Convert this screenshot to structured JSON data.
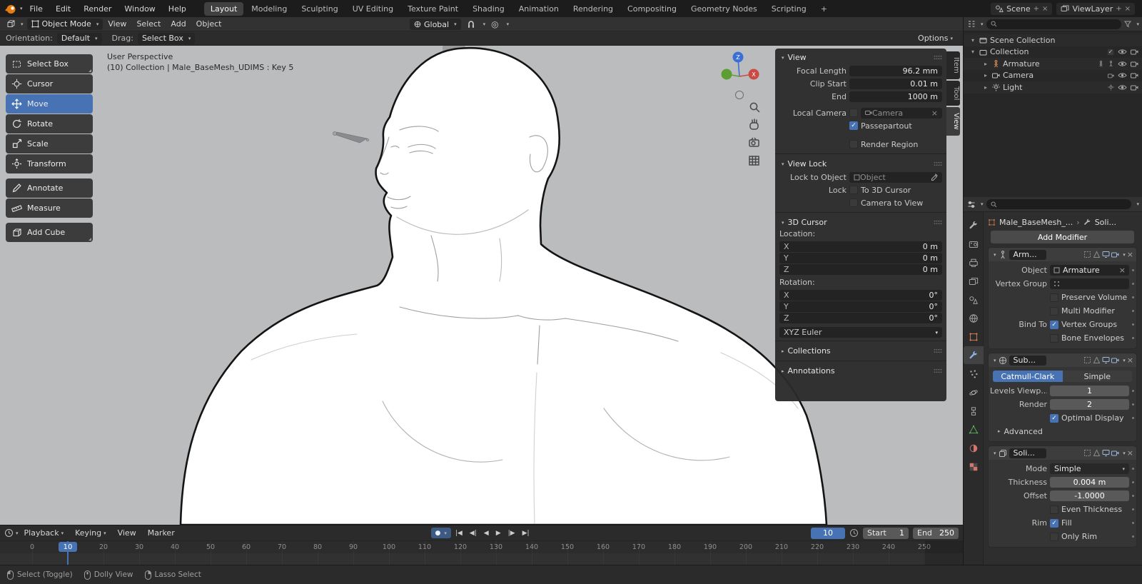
{
  "colors": {
    "accent": "#4772b3",
    "axis_x": "#cc4a44",
    "axis_y": "#5c9e31",
    "axis_z": "#3c6fd6",
    "viewport_bg": "#bbbcbe"
  },
  "topbar": {
    "menus": [
      "File",
      "Edit",
      "Render",
      "Window",
      "Help"
    ],
    "workspaces": [
      "Layout",
      "Modeling",
      "Sculpting",
      "UV Editing",
      "Texture Paint",
      "Shading",
      "Animation",
      "Rendering",
      "Compositing",
      "Geometry Nodes",
      "Scripting"
    ],
    "add_workspace": "+",
    "scene": "Scene",
    "view_layer": "ViewLayer"
  },
  "header": {
    "mode": "Object Mode",
    "menus": [
      "View",
      "Select",
      "Add",
      "Object"
    ],
    "orientation": "Global"
  },
  "tools_bar": {
    "orientation_label": "Orientation:",
    "orientation_value": "Default",
    "drag_label": "Drag:",
    "drag_value": "Select Box",
    "options": "Options"
  },
  "toolshelf": {
    "tools": [
      {
        "label": "Select Box"
      },
      {
        "label": "Cursor"
      },
      {
        "label": "Move"
      },
      {
        "label": "Rotate"
      },
      {
        "label": "Scale"
      },
      {
        "label": "Transform"
      },
      {
        "label": "Annotate"
      },
      {
        "label": "Measure"
      },
      {
        "label": "Add Cube"
      }
    ]
  },
  "viewport": {
    "perspective": "User Perspective",
    "context": "(10) Collection | Male_BaseMesh_UDIMS : Key 5",
    "axis_x": "X",
    "axis_z": "Z"
  },
  "npanel": {
    "tabs": [
      {
        "label": "Item"
      },
      {
        "label": "Tool"
      },
      {
        "label": "View"
      }
    ],
    "view_title": "View",
    "focal_label": "Focal Length",
    "focal_value": "96.2 mm",
    "clip_label": "Clip Start",
    "clip_value": "0.01 m",
    "end_label": "End",
    "end_value": "1000 m",
    "local_camera": "Local Camera",
    "camera_value": "Camera",
    "passepartout": "Passepartout",
    "render_region": "Render Region",
    "lock_title": "View Lock",
    "lock_to_object": "Lock to Object",
    "object_placeholder": "Object",
    "lock_label": "Lock",
    "to_3d_cursor": "To 3D Cursor",
    "camera_to_view": "Camera to View",
    "cursor_title": "3D Cursor",
    "location_label": "Location:",
    "loc": [
      {
        "axis": "X",
        "value": "0 m"
      },
      {
        "axis": "Y",
        "value": "0 m"
      },
      {
        "axis": "Z",
        "value": "0 m"
      }
    ],
    "rotation_label": "Rotation:",
    "rot": [
      {
        "axis": "X",
        "value": "0°"
      },
      {
        "axis": "Y",
        "value": "0°"
      },
      {
        "axis": "Z",
        "value": "0°"
      }
    ],
    "euler": "XYZ Euler",
    "collections_title": "Collections",
    "annotations_title": "Annotations"
  },
  "outliner": {
    "rows": [
      {
        "label": "Scene Collection"
      },
      {
        "label": "Collection"
      },
      {
        "label": "Armature"
      },
      {
        "label": "Camera"
      },
      {
        "label": "Light"
      }
    ]
  },
  "properties": {
    "breadcrumb_object": "Male_BaseMesh_...",
    "breadcrumb_sep": "›",
    "breadcrumb_modifier": "Soli...",
    "add_modifier": "Add Modifier",
    "armature": {
      "name": "Arm...",
      "object_label": "Object",
      "object_value": "Armature",
      "vertex_group_label": "Vertex Group",
      "preserve_volume": "Preserve Volume",
      "multi_modifier": "Multi Modifier",
      "bind_to_label": "Bind To",
      "vertex_groups": "Vertex Groups",
      "bone_envelopes": "Bone Envelopes"
    },
    "subdivision": {
      "name": "Sub...",
      "catmull": "Catmull-Clark",
      "simple": "Simple",
      "levels_label": "Levels Viewp...",
      "levels_value": "1",
      "render_label": "Render",
      "render_value": "2",
      "optimal_display": "Optimal Display",
      "advanced": "Advanced"
    },
    "solidify": {
      "name": "Soli...",
      "mode_label": "Mode",
      "mode_value": "Simple",
      "thickness_label": "Thickness",
      "thickness_value": "0.004 m",
      "offset_label": "Offset",
      "offset_value": "-1.0000",
      "even_thickness": "Even Thickness",
      "rim_label": "Rim",
      "fill": "Fill",
      "only_rim": "Only Rim"
    }
  },
  "timeline": {
    "menus": [
      "Playback",
      "Keying",
      "View",
      "Marker"
    ],
    "transport": [
      "|◀",
      "◀|",
      "◀",
      "▶",
      "|▶",
      "▶|"
    ],
    "current_frame": "10",
    "start_label": "Start",
    "start_value": "1",
    "end_label": "End",
    "end_value": "250",
    "playhead_frame": 10,
    "frame_min": 0,
    "frame_max": 250,
    "ruler_labels": [
      0,
      20,
      30,
      40,
      50,
      60,
      70,
      80,
      90,
      100,
      110,
      120,
      130,
      140,
      150,
      160,
      170,
      180,
      190,
      200,
      210,
      220,
      230,
      240,
      250
    ]
  },
  "statusbar": {
    "hints": [
      {
        "label": "Select (Toggle)"
      },
      {
        "label": "Dolly View"
      },
      {
        "label": "Lasso Select"
      }
    ]
  }
}
